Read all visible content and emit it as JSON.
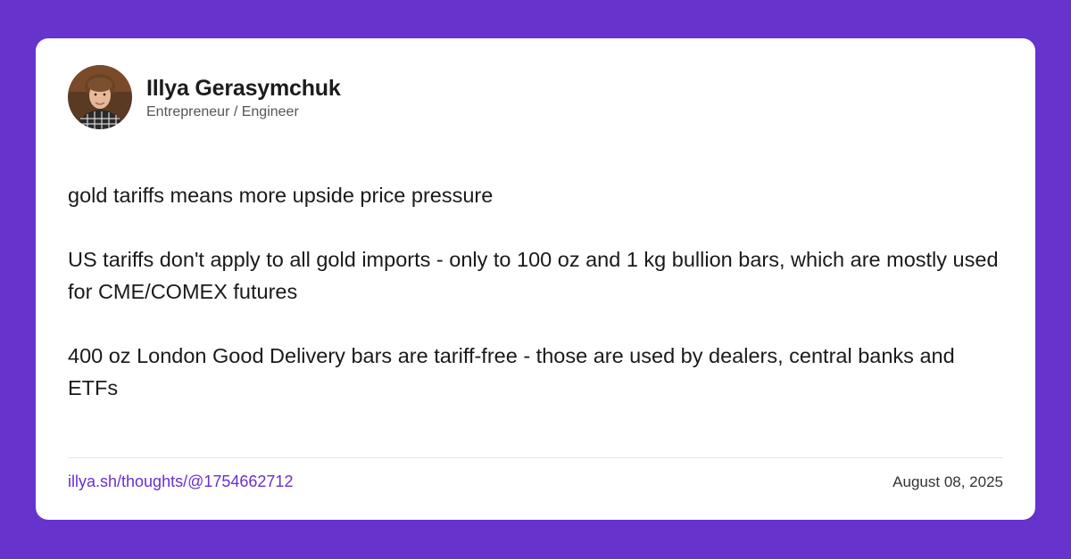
{
  "author": {
    "name": "Illya Gerasymchuk",
    "title": "Entrepreneur / Engineer",
    "avatar_icon": "profile-photo"
  },
  "post": {
    "paragraphs": [
      "gold tariffs means more upside price pressure",
      "US tariffs don't apply to all gold imports - only to 100 oz and 1 kg bullion bars, which are mostly used for CME/COMEX futures",
      "400 oz London Good Delivery bars are tariff-free - those are used by dealers, central banks and ETFs"
    ]
  },
  "footer": {
    "link_text": "illya.sh/thoughts/@1754662712",
    "date": "August 08, 2025"
  },
  "colors": {
    "background": "#6633cc",
    "card": "#ffffff",
    "link": "#6a2fd0"
  }
}
